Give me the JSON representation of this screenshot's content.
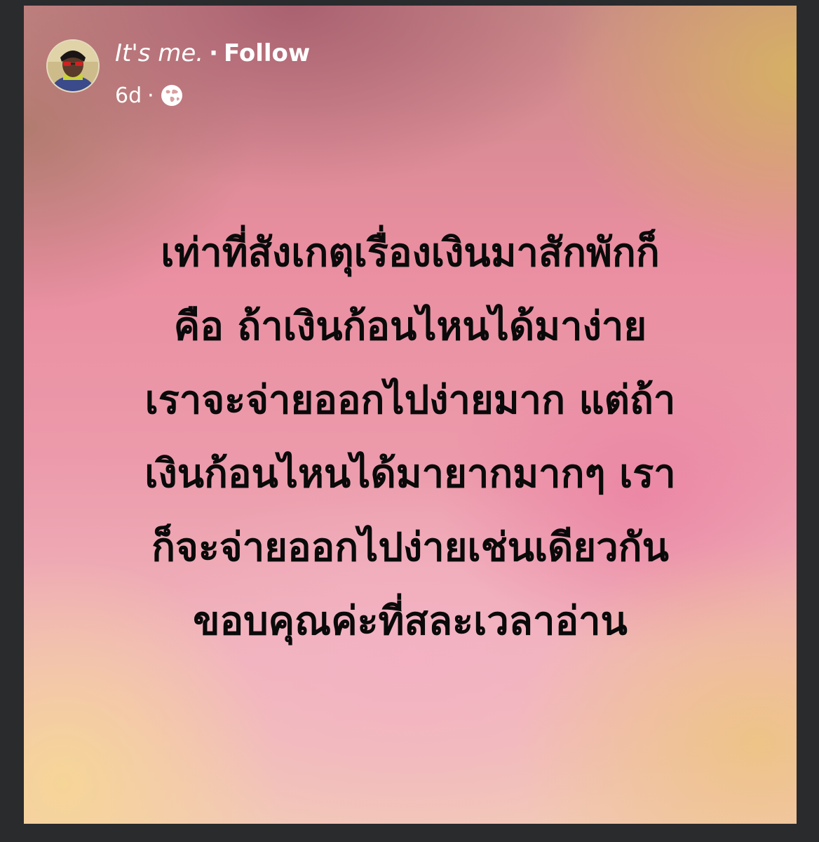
{
  "post": {
    "author": "It's me.",
    "separator": "·",
    "follow_label": "Follow",
    "time": "6d",
    "time_separator": "·",
    "privacy_icon": "globe-icon",
    "body_lines": [
      "เท่าที่สังเกตุเรื่องเงินมาสักพักก็",
      "คือ ถ้าเงินก้อนไหนได้มาง่าย",
      "เราจะจ่ายออกไปง่ายมาก แต่ถ้า",
      "เงินก้อนไหนได้มายากมากๆ เรา",
      "ก็จะจ่ายออกไปง่ายเช่นเดียวกัน",
      "ขอบคุณค่ะที่สละเวลาอ่าน"
    ]
  },
  "colors": {
    "text": "#0a0a0a",
    "header_text": "#ffffff",
    "frame": "#2a2b2d"
  }
}
